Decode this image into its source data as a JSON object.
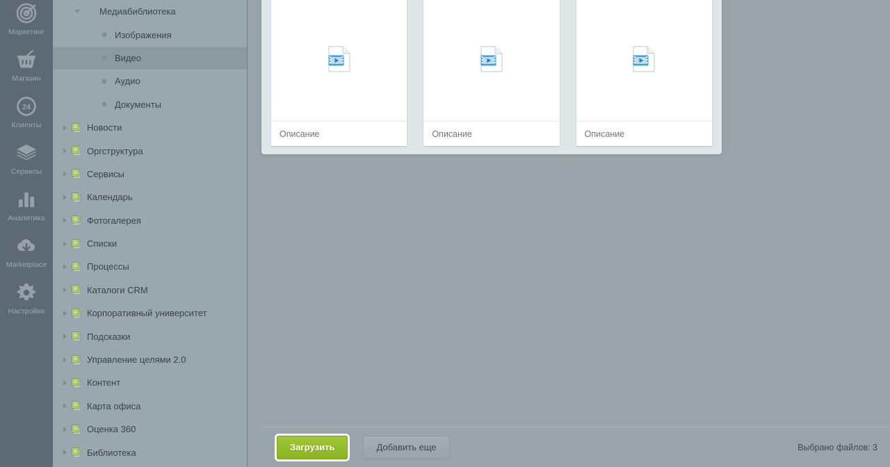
{
  "rail": {
    "items": [
      {
        "label": "Маркетинг",
        "icon": "target-icon"
      },
      {
        "label": "Магазин",
        "icon": "basket-icon"
      },
      {
        "label": "Клиенты",
        "icon": "clock24-icon"
      },
      {
        "label": "Сервисы",
        "icon": "layers-icon"
      },
      {
        "label": "Аналитика",
        "icon": "bar-chart-icon"
      },
      {
        "label": "Marketplace",
        "icon": "cloud-download-icon"
      },
      {
        "label": "Настройки",
        "icon": "gear-icon"
      }
    ]
  },
  "tree": {
    "items": [
      {
        "label": "Медиабиблиотека",
        "depth": 1,
        "icon": "chevron-down-icon",
        "expanded": true,
        "selected": false,
        "type": "folder-open"
      },
      {
        "label": "Изображения",
        "depth": 2,
        "icon": "bullet-icon",
        "expanded": false,
        "selected": false,
        "type": "leaf"
      },
      {
        "label": "Видео",
        "depth": 2,
        "icon": "bullet-icon",
        "expanded": false,
        "selected": true,
        "type": "leaf"
      },
      {
        "label": "Аудио",
        "depth": 2,
        "icon": "bullet-icon",
        "expanded": false,
        "selected": false,
        "type": "leaf"
      },
      {
        "label": "Документы",
        "depth": 2,
        "icon": "bullet-icon",
        "expanded": false,
        "selected": false,
        "type": "leaf"
      },
      {
        "label": "Новости",
        "depth": 0,
        "icon": "chevron-right-icon",
        "expanded": false,
        "selected": false,
        "type": "pages"
      },
      {
        "label": "Оргструктура",
        "depth": 0,
        "icon": "chevron-right-icon",
        "expanded": false,
        "selected": false,
        "type": "pages"
      },
      {
        "label": "Сервисы",
        "depth": 0,
        "icon": "chevron-right-icon",
        "expanded": false,
        "selected": false,
        "type": "pages"
      },
      {
        "label": "Календарь",
        "depth": 0,
        "icon": "chevron-right-icon",
        "expanded": false,
        "selected": false,
        "type": "pages"
      },
      {
        "label": "Фотогалерея",
        "depth": 0,
        "icon": "chevron-right-icon",
        "expanded": false,
        "selected": false,
        "type": "pages"
      },
      {
        "label": "Списки",
        "depth": 0,
        "icon": "chevron-right-icon",
        "expanded": false,
        "selected": false,
        "type": "pages"
      },
      {
        "label": "Процессы",
        "depth": 0,
        "icon": "chevron-right-icon",
        "expanded": false,
        "selected": false,
        "type": "pages"
      },
      {
        "label": "Каталоги CRM",
        "depth": 0,
        "icon": "chevron-right-icon",
        "expanded": false,
        "selected": false,
        "type": "pages"
      },
      {
        "label": "Корпоративный университет",
        "depth": 0,
        "icon": "chevron-right-icon",
        "expanded": false,
        "selected": false,
        "type": "pages"
      },
      {
        "label": "Подсказки",
        "depth": 0,
        "icon": "chevron-right-icon",
        "expanded": false,
        "selected": false,
        "type": "pages"
      },
      {
        "label": "Управление целями 2.0",
        "depth": 0,
        "icon": "chevron-right-icon",
        "expanded": false,
        "selected": false,
        "type": "pages"
      },
      {
        "label": "Контент",
        "depth": 0,
        "icon": "chevron-right-icon",
        "expanded": false,
        "selected": false,
        "type": "pages"
      },
      {
        "label": "Карта офиса",
        "depth": 0,
        "icon": "chevron-right-icon",
        "expanded": false,
        "selected": false,
        "type": "pages"
      },
      {
        "label": "Оценка 360",
        "depth": 0,
        "icon": "chevron-right-icon",
        "expanded": false,
        "selected": false,
        "type": "pages"
      },
      {
        "label": "Библиотека",
        "depth": 0,
        "icon": "chevron-right-icon",
        "expanded": false,
        "selected": false,
        "type": "pages"
      }
    ]
  },
  "upload": {
    "cards": [
      {
        "caption": "Описание",
        "icon": "video-file-icon"
      },
      {
        "caption": "Описание",
        "icon": "video-file-icon"
      },
      {
        "caption": "Описание",
        "icon": "video-file-icon"
      }
    ]
  },
  "bottom_bar": {
    "upload_label": "Загрузить",
    "add_more_label": "Добавить еще",
    "selected_count_text": "Выбрано файлов: 3"
  },
  "colors": {
    "accent_green": "#95bc2a",
    "rail_bg": "#4e5a65",
    "tree_bg": "#9aa7ae",
    "overlay_bg": "#98a3aa",
    "panel_bg": "#dfe6e8",
    "video_icon_blue": "#4a9fd8"
  }
}
